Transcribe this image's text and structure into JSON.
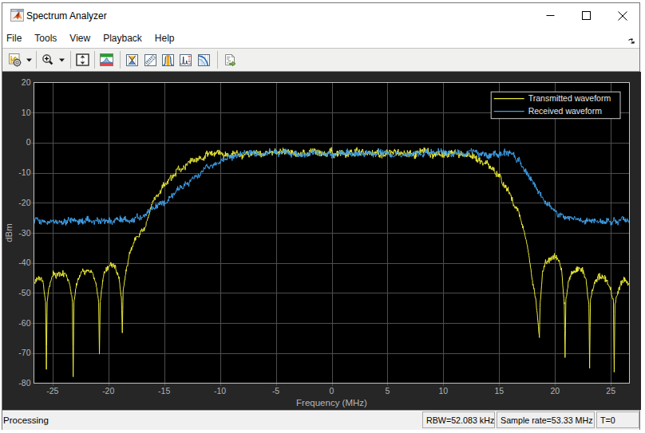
{
  "window": {
    "title": "Spectrum Analyzer",
    "controls": {
      "minimize": "minimize",
      "maximize": "maximize",
      "close": "close"
    }
  },
  "menu": {
    "items": [
      {
        "label": "File"
      },
      {
        "label": "Tools"
      },
      {
        "label": "View"
      },
      {
        "label": "Playback"
      },
      {
        "label": "Help"
      }
    ]
  },
  "toolbar": {
    "icons": [
      "spectrum-settings-icon",
      "spectrum-settings-dropdown-icon",
      "zoom-in-icon",
      "zoom-dropdown-icon",
      "autoscale-y-icon",
      "spectrum-display-icon",
      "cursor-measurements-icon",
      "peak-finder-icon",
      "channel-measurements-icon",
      "distortion-measurements-icon",
      "ccdf-measurements-icon",
      "generate-script-icon"
    ]
  },
  "statusbar": {
    "left_text": "Processing",
    "cells": [
      "RBW=52.083 kHz",
      "Sample rate=53.33 MHz",
      "T=0"
    ]
  },
  "chart_data": {
    "type": "line",
    "title": "",
    "xlabel": "Frequency (MHz)",
    "ylabel": "dBm",
    "xlim": [
      -26.665,
      26.665
    ],
    "ylim": [
      -80,
      20
    ],
    "x_ticks": [
      -25,
      -20,
      -15,
      -10,
      -5,
      0,
      5,
      10,
      15,
      20,
      25
    ],
    "y_ticks": [
      20,
      10,
      0,
      -10,
      -20,
      -30,
      -40,
      -50,
      -60,
      -70,
      -80
    ],
    "grid": true,
    "legend_position": "top-right",
    "colors": {
      "figure_bg": "#262626",
      "plot_bg": "#000000",
      "grid": "#4e4e4e",
      "axis_border": "#c2c2c2",
      "tick_label": "#b5b5b5",
      "legend_bg": "#000000",
      "legend_border": "#cccccc",
      "legend_text": "#e8e8e8"
    },
    "series": [
      {
        "name": "Transmitted waveform",
        "color": "#e9e93a",
        "noise_db": 1.45,
        "seed": 101,
        "envelope": [
          [
            -26.665,
            -46.5
          ],
          [
            -26.2,
            -45.0
          ],
          [
            -25.85,
            -46.2
          ],
          [
            -25.62,
            -53.0
          ],
          [
            -25.55,
            -75.5
          ],
          [
            -25.48,
            -53.0
          ],
          [
            -25.25,
            -47.4
          ],
          [
            -24.95,
            -44.1
          ],
          [
            -24.35,
            -42.9
          ],
          [
            -23.75,
            -44.1
          ],
          [
            -23.45,
            -47.4
          ],
          [
            -23.22,
            -53.0
          ],
          [
            -23.15,
            -78.0
          ],
          [
            -23.08,
            -53.0
          ],
          [
            -22.85,
            -46.4
          ],
          [
            -22.55,
            -43.1
          ],
          [
            -21.975,
            -41.9
          ],
          [
            -21.4,
            -43.1
          ],
          [
            -21.1,
            -46.4
          ],
          [
            -20.87,
            -53.0
          ],
          [
            -20.8,
            -70.5
          ],
          [
            -20.73,
            -53.0
          ],
          [
            -20.5,
            -45.1
          ],
          [
            -20.2,
            -41.8
          ],
          [
            -19.775,
            -40.6
          ],
          [
            -19.35,
            -41.8
          ],
          [
            -19.05,
            -45.1
          ],
          [
            -18.82,
            -53.0
          ],
          [
            -18.75,
            -63.5
          ],
          [
            -18.68,
            -50.0
          ],
          [
            -18.4,
            -42.0
          ],
          [
            -18.1,
            -36.5
          ],
          [
            -17.6,
            -31.8
          ],
          [
            -16.8,
            -28.6
          ],
          [
            -16.2,
            -21.3
          ],
          [
            -15.4,
            -16.0
          ],
          [
            -14.4,
            -11.8
          ],
          [
            -13.4,
            -8.2
          ],
          [
            -12.3,
            -5.8
          ],
          [
            -11.1,
            -4.1
          ],
          [
            -10.2,
            -3.8
          ],
          [
            -8.0,
            -3.6
          ],
          [
            -5.0,
            -3.5
          ],
          [
            -2.0,
            -3.4
          ],
          [
            0.0,
            -3.4
          ],
          [
            3.0,
            -3.4
          ],
          [
            6.0,
            -3.5
          ],
          [
            8.0,
            -3.5
          ],
          [
            10.0,
            -3.7
          ],
          [
            11.5,
            -4.1
          ],
          [
            12.5,
            -4.7
          ],
          [
            13.8,
            -6.9
          ],
          [
            14.6,
            -9.4
          ],
          [
            15.2,
            -12.2
          ],
          [
            15.8,
            -15.4
          ],
          [
            16.2,
            -19.1
          ],
          [
            16.7,
            -23.3
          ],
          [
            17.1,
            -27.4
          ],
          [
            17.6,
            -35.7
          ],
          [
            18.0,
            -46.4
          ],
          [
            18.3,
            -53.0
          ],
          [
            18.6,
            -64.5
          ],
          [
            18.67,
            -53.0
          ],
          [
            18.9,
            -42.4
          ],
          [
            19.2,
            -39.1
          ],
          [
            19.75,
            -37.9
          ],
          [
            20.3,
            -39.1
          ],
          [
            20.6,
            -42.4
          ],
          [
            20.83,
            -53.0
          ],
          [
            20.9,
            -71.5
          ],
          [
            20.97,
            -53.0
          ],
          [
            21.2,
            -46.7
          ],
          [
            21.5,
            -43.4
          ],
          [
            22.0,
            -42.2
          ],
          [
            22.5,
            -43.4
          ],
          [
            22.8,
            -46.7
          ],
          [
            23.03,
            -53.0
          ],
          [
            23.1,
            -75.0
          ],
          [
            23.17,
            -53.0
          ],
          [
            23.4,
            -49.1
          ],
          [
            23.7,
            -45.8
          ],
          [
            24.2,
            -44.6
          ],
          [
            24.7,
            -45.8
          ],
          [
            25.0,
            -49.1
          ],
          [
            25.23,
            -53.0
          ],
          [
            25.3,
            -76.5
          ],
          [
            25.37,
            -54.0
          ],
          [
            25.75,
            -47.6
          ],
          [
            26.25,
            -45.8
          ],
          [
            26.665,
            -46.3
          ]
        ]
      },
      {
        "name": "Received waveform",
        "color": "#42a1ea",
        "noise_db": 1.25,
        "seed": 202,
        "envelope": [
          [
            -26.665,
            -26.1
          ],
          [
            -24.0,
            -26.0
          ],
          [
            -21.0,
            -25.9
          ],
          [
            -19.0,
            -25.9
          ],
          [
            -18.0,
            -25.8
          ],
          [
            -17.4,
            -25.2
          ],
          [
            -16.4,
            -23.3
          ],
          [
            -15.4,
            -20.6
          ],
          [
            -14.6,
            -18.8
          ],
          [
            -13.8,
            -16.1
          ],
          [
            -12.9,
            -13.5
          ],
          [
            -12.1,
            -11.2
          ],
          [
            -11.1,
            -8.5
          ],
          [
            -10.1,
            -6.6
          ],
          [
            -8.9,
            -4.8
          ],
          [
            -7.6,
            -3.8
          ],
          [
            -5.0,
            -3.6
          ],
          [
            -2.0,
            -3.5
          ],
          [
            0.0,
            -3.5
          ],
          [
            3.0,
            -3.4
          ],
          [
            6.0,
            -3.5
          ],
          [
            9.0,
            -3.5
          ],
          [
            12.0,
            -3.6
          ],
          [
            14.0,
            -3.8
          ],
          [
            15.5,
            -4.0
          ],
          [
            16.25,
            -4.3
          ],
          [
            16.9,
            -6.3
          ],
          [
            17.5,
            -10.0
          ],
          [
            18.1,
            -13.8
          ],
          [
            18.7,
            -17.3
          ],
          [
            19.3,
            -20.3
          ],
          [
            19.9,
            -22.6
          ],
          [
            20.5,
            -24.1
          ],
          [
            21.5,
            -25.3
          ],
          [
            22.5,
            -25.9
          ],
          [
            24.0,
            -26.0
          ],
          [
            26.665,
            -26.1
          ]
        ]
      }
    ]
  }
}
